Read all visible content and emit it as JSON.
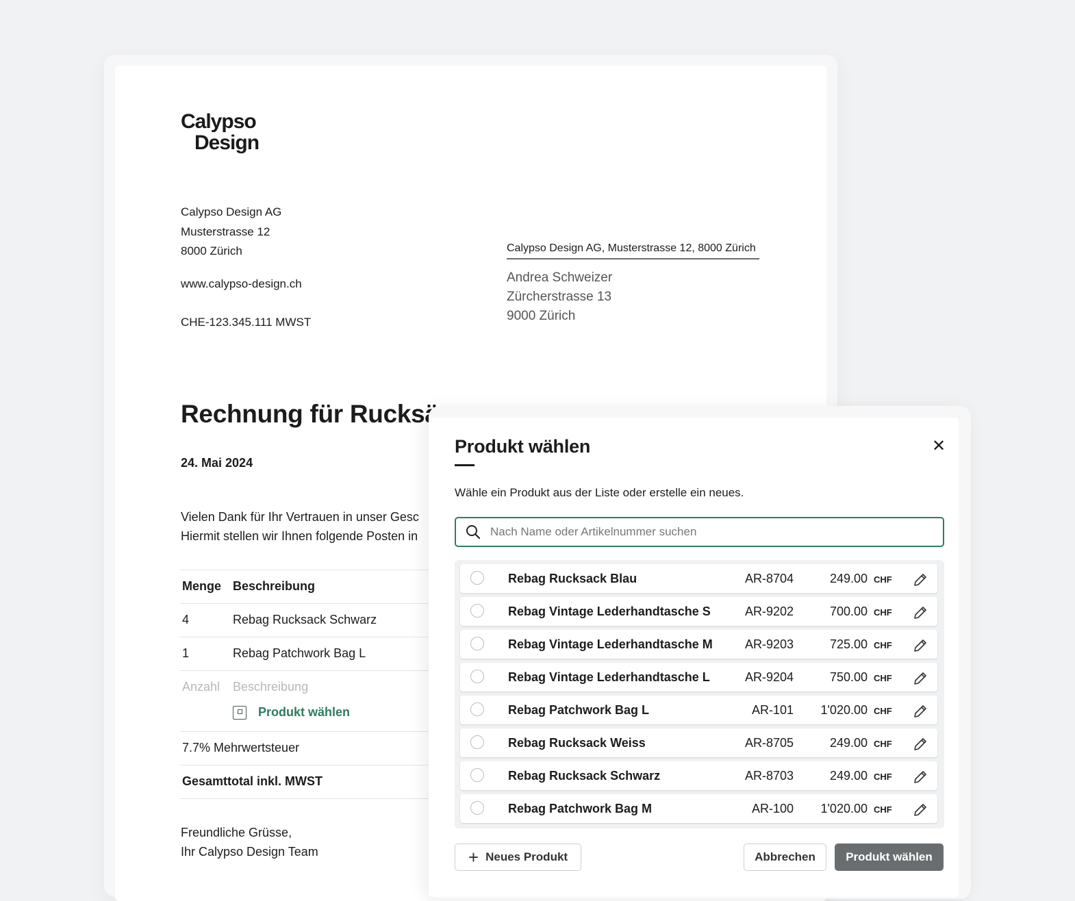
{
  "document": {
    "logo": {
      "line1": "Calypso",
      "line2": "Design"
    },
    "sender": {
      "company": "Calypso Design AG",
      "street": "Musterstrasse 12",
      "city": "8000 Zürich",
      "website": "www.calypso-design.ch",
      "vat": "CHE-123.345.111 MWST"
    },
    "return_address": "Calypso Design AG, Musterstrasse 12, 8000 Zürich",
    "recipient": {
      "name": "Andrea Schweizer",
      "street": "Zürcherstrasse 13",
      "city": "9000 Zürich"
    },
    "title": "Rechnung für Rucksä",
    "date": "24. Mai 2024",
    "intro_line1": "Vielen Dank für Ihr Vertrauen in unser Gesc",
    "intro_line2": "Hiermit stellen wir Ihnen folgende Posten in",
    "table": {
      "header_qty": "Menge",
      "header_desc": "Beschreibung",
      "rows": [
        {
          "qty": "4",
          "desc": "Rebag Rucksack Schwarz"
        },
        {
          "qty": "1",
          "desc": "Rebag Patchwork Bag L"
        }
      ],
      "placeholder_qty": "Anzahl",
      "placeholder_desc": "Beschreibung",
      "pick_product_link": "Produkt wählen",
      "vat_row": "7.7% Mehrwertsteuer",
      "total_row": "Gesamttotal inkl. MWST"
    },
    "closing_line1": "Freundliche Grüsse,",
    "closing_line2": "Ihr Calypso Design Team"
  },
  "modal": {
    "title": "Produkt wählen",
    "close_symbol": "✕",
    "subtitle": "Wähle ein Produkt aus der Liste oder erstelle ein neues.",
    "search_placeholder": "Nach Name oder Artikelnummer suchen",
    "currency": "CHF",
    "products": [
      {
        "name": "Rebag Rucksack Blau",
        "sku": "AR-8704",
        "price": "249.00"
      },
      {
        "name": "Rebag Vintage Lederhandtasche S",
        "sku": "AR-9202",
        "price": "700.00"
      },
      {
        "name": "Rebag Vintage Lederhandtasche M",
        "sku": "AR-9203",
        "price": "725.00"
      },
      {
        "name": "Rebag Vintage Lederhandtasche L",
        "sku": "AR-9204",
        "price": "750.00"
      },
      {
        "name": "Rebag Patchwork Bag L",
        "sku": "AR-101",
        "price": "1'020.00"
      },
      {
        "name": "Rebag Rucksack Weiss",
        "sku": "AR-8705",
        "price": "249.00"
      },
      {
        "name": "Rebag Rucksack Schwarz",
        "sku": "AR-8703",
        "price": "249.00"
      },
      {
        "name": "Rebag Patchwork Bag M",
        "sku": "AR-100",
        "price": "1'020.00"
      }
    ],
    "new_product_plus": "+",
    "new_product_label": "Neues Produkt",
    "cancel_label": "Abbrechen",
    "choose_label": "Produkt wählen"
  },
  "colors": {
    "accent": "#2e7d5f",
    "primary_button": "#6a6d6f",
    "background": "#f1f2f4"
  }
}
